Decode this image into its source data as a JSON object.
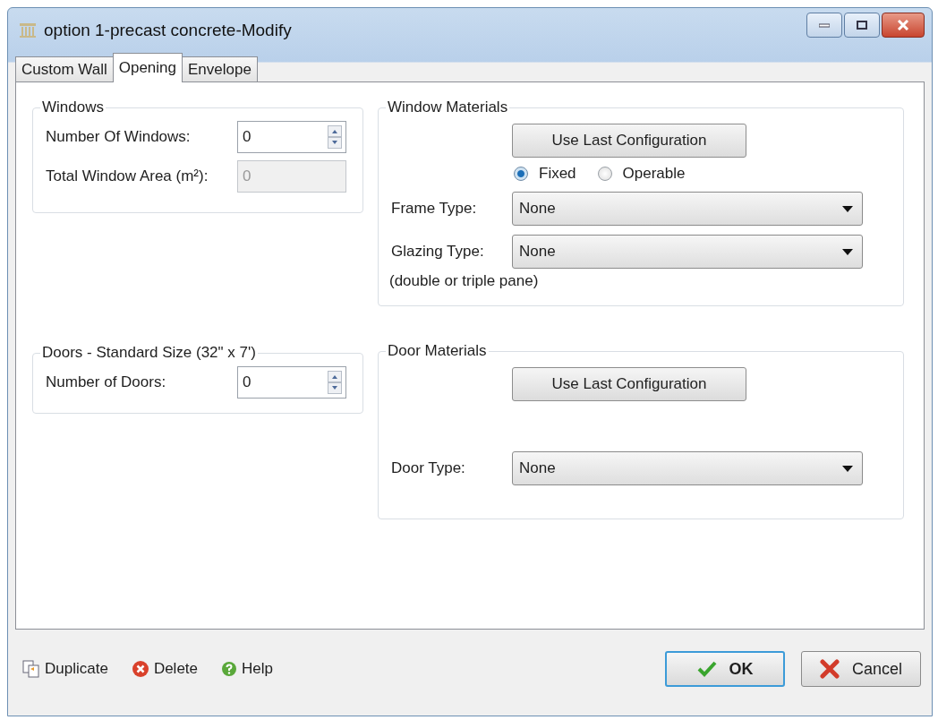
{
  "window": {
    "title": "option 1-precast concrete-Modify"
  },
  "tabs": [
    {
      "label": "Custom Wall",
      "selected": false
    },
    {
      "label": "Opening",
      "selected": true
    },
    {
      "label": "Envelope",
      "selected": false
    }
  ],
  "windows_group": {
    "title": "Windows",
    "fields": [
      {
        "kind": "spinner",
        "label": "Number Of Windows:",
        "value": "0",
        "disabled": false
      },
      {
        "kind": "text",
        "label": "Total Window Area (m²):",
        "value": "0",
        "disabled": true
      }
    ]
  },
  "window_materials": {
    "title": "Window Materials",
    "button": "Use Last Configuration",
    "radios": [
      {
        "label": "Fixed",
        "selected": true
      },
      {
        "label": "Operable",
        "selected": false
      }
    ],
    "dropdowns": [
      {
        "label": "Frame Type:",
        "value": "None"
      },
      {
        "label": "Glazing Type:",
        "value": "None"
      }
    ],
    "note": "(double or triple pane)"
  },
  "doors_group": {
    "title": "Doors - Standard Size (32\" x 7')",
    "fields": [
      {
        "kind": "spinner",
        "label": "Number of Doors:",
        "value": "0",
        "disabled": false
      }
    ]
  },
  "door_materials": {
    "title": "Door Materials",
    "button": "Use Last Configuration",
    "dropdowns": [
      {
        "label": "Door Type:",
        "value": "None"
      }
    ]
  },
  "footer": {
    "links": [
      {
        "kind": "duplicate",
        "label": "Duplicate"
      },
      {
        "kind": "delete",
        "label": "Delete"
      },
      {
        "kind": "help",
        "label": "Help"
      }
    ],
    "buttons": [
      {
        "kind": "ok",
        "label": "OK"
      },
      {
        "kind": "cancel",
        "label": "Cancel"
      }
    ]
  }
}
